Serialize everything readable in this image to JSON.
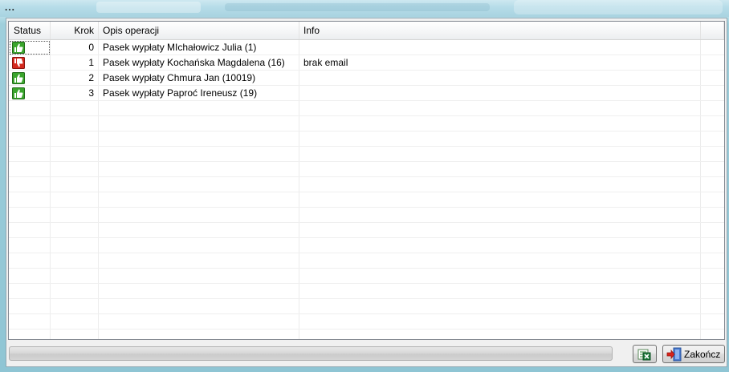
{
  "window": {
    "title": "..."
  },
  "grid": {
    "columns": {
      "status": "Status",
      "krok": "Krok",
      "opis": "Opis operacji",
      "info": "Info"
    },
    "rows": [
      {
        "status": "ok",
        "krok": "0",
        "opis": "Pasek wypłaty MIchałowicz Julia  (1)",
        "info": ""
      },
      {
        "status": "error",
        "krok": "1",
        "opis": "Pasek wypłaty Kochańska Magdalena  (16)",
        "info": "brak email"
      },
      {
        "status": "ok",
        "krok": "2",
        "opis": "Pasek wypłaty Chmura Jan  (10019)",
        "info": ""
      },
      {
        "status": "ok",
        "krok": "3",
        "opis": "Pasek wypłaty Paproć Ireneusz  (19)",
        "info": ""
      }
    ]
  },
  "status_icons": {
    "ok": "thumbs-up-icon",
    "error": "thumbs-down-icon"
  },
  "colors": {
    "ok": "#3aa52c",
    "error": "#d42a1f"
  },
  "footer": {
    "progress": 0,
    "excel_icon": "excel-export-icon",
    "close_label": "Zakończ",
    "close_icon": "exit-door-icon"
  }
}
